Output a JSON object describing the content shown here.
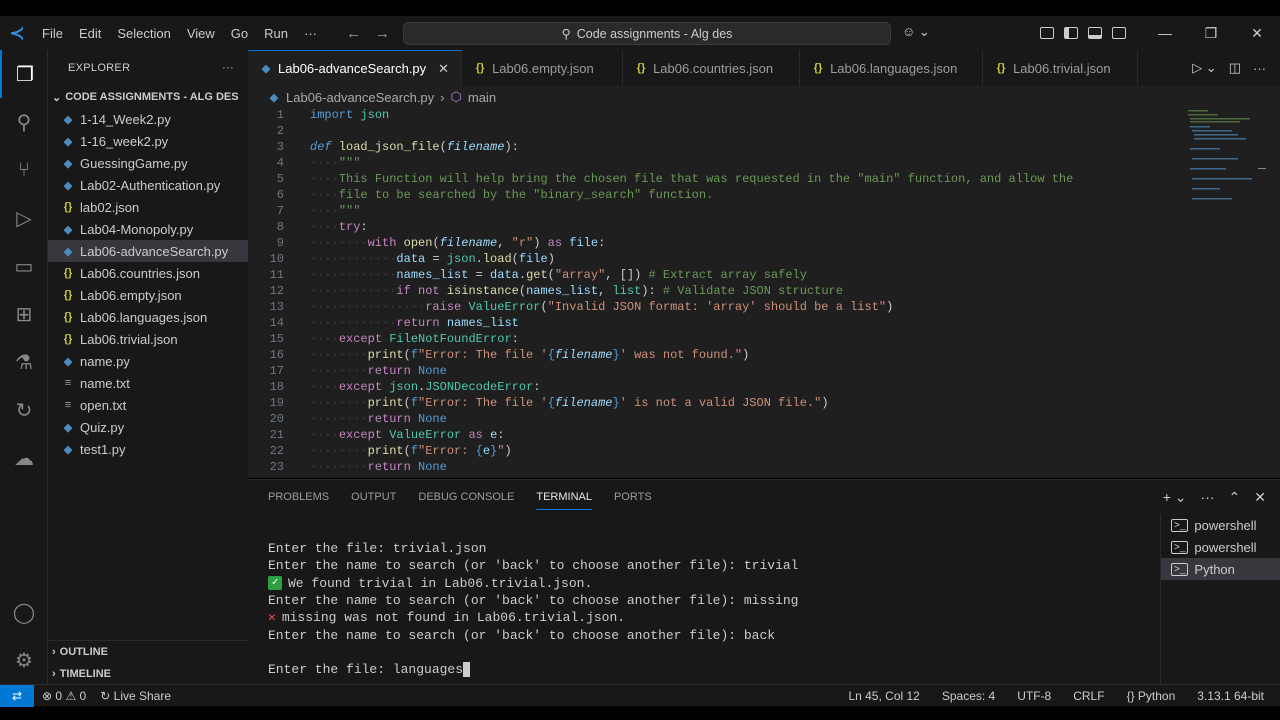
{
  "titlebar": {
    "menu": [
      "File",
      "Edit",
      "Selection",
      "View",
      "Go",
      "Run",
      "···"
    ],
    "search": "Code assignments - Alg des"
  },
  "sidebar": {
    "title": "EXPLORER",
    "folder": "CODE ASSIGNMENTS - ALG DES",
    "files": [
      {
        "name": "1-14_Week2.py",
        "type": "py"
      },
      {
        "name": "1-16_week2.py",
        "type": "py"
      },
      {
        "name": "GuessingGame.py",
        "type": "py"
      },
      {
        "name": "Lab02-Authentication.py",
        "type": "py"
      },
      {
        "name": "lab02.json",
        "type": "json"
      },
      {
        "name": "Lab04-Monopoly.py",
        "type": "py"
      },
      {
        "name": "Lab06-advanceSearch.py",
        "type": "py"
      },
      {
        "name": "Lab06.countries.json",
        "type": "json"
      },
      {
        "name": "Lab06.empty.json",
        "type": "json"
      },
      {
        "name": "Lab06.languages.json",
        "type": "json"
      },
      {
        "name": "Lab06.trivial.json",
        "type": "json"
      },
      {
        "name": "name.py",
        "type": "py"
      },
      {
        "name": "name.txt",
        "type": "txt"
      },
      {
        "name": "open.txt",
        "type": "txt"
      },
      {
        "name": "Quiz.py",
        "type": "py"
      },
      {
        "name": "test1.py",
        "type": "py"
      }
    ],
    "outline": "OUTLINE",
    "timeline": "TIMELINE"
  },
  "tabs": [
    {
      "label": "Lab06-advanceSearch.py",
      "icon": "python-file-icon"
    },
    {
      "label": "Lab06.empty.json",
      "icon": "json-file-icon"
    },
    {
      "label": "Lab06.countries.json",
      "icon": "json-file-icon"
    },
    {
      "label": "Lab06.languages.json",
      "icon": "json-file-icon"
    },
    {
      "label": "Lab06.trivial.json",
      "icon": "json-file-icon"
    }
  ],
  "breadcrumb": {
    "file": "Lab06-advanceSearch.py",
    "symbol": "main"
  },
  "editor": {
    "line_numbers": [
      "1",
      "2",
      "3",
      "4",
      "5",
      "6",
      "7",
      "8",
      "9",
      "10",
      "11",
      "12",
      "13",
      "14",
      "15",
      "16",
      "17",
      "18",
      "19",
      "20",
      "21",
      "22",
      "23"
    ]
  },
  "panel": {
    "tabs": [
      "PROBLEMS",
      "OUTPUT",
      "DEBUG CONSOLE",
      "TERMINAL",
      "PORTS"
    ],
    "terminal_lines": [
      "Enter the file: trivial.json",
      "Enter the name to search (or 'back' to choose another file): trivial",
      "We found trivial in Lab06.trivial.json.",
      "Enter the name to search (or 'back' to choose another file): missing",
      "missing was not found in Lab06.trivial.json.",
      "Enter the name to search (or 'back' to choose another file): back",
      "",
      "Enter the file: languages"
    ],
    "terminals": [
      "powershell",
      "powershell",
      "Python"
    ]
  },
  "statusbar": {
    "errors": "0",
    "warnings": "0",
    "liveshare": "Live Share",
    "position": "Ln 45, Col 12",
    "spaces": "Spaces: 4",
    "encoding": "UTF-8",
    "eol": "CRLF",
    "language": "Python",
    "interpreter": "3.13.1 64-bit"
  },
  "colors": {
    "accent": "#0078d4",
    "bg": "#1f1f1f",
    "sidebar": "#181818"
  }
}
